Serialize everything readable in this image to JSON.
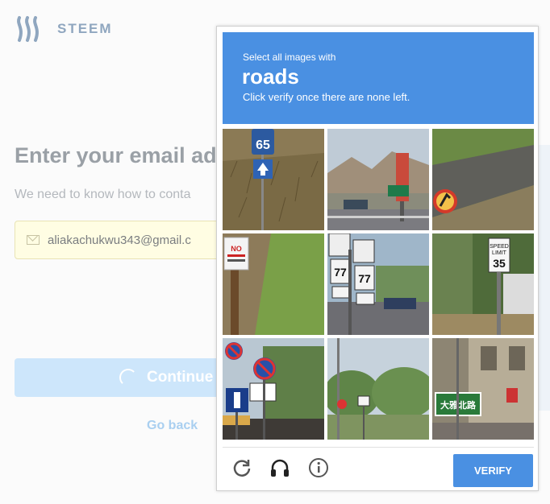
{
  "background": {
    "logo_text": "STEEM",
    "heading": "Enter your email ad",
    "subtext": "We need to know how to conta",
    "email_value": "aliakachukwu343@gmail.c",
    "continue_label": "Continue",
    "go_back_label": "Go back"
  },
  "captcha": {
    "instruction_prefix": "Select all images with",
    "keyword": "roads",
    "instruction_suffix": "Click verify once there are none left.",
    "verify_label": "VERIFY",
    "tools": [
      {
        "icon": "reload-icon"
      },
      {
        "icon": "headphones-icon"
      },
      {
        "icon": "info-icon"
      }
    ],
    "tiles": [
      {
        "name": "tile-1",
        "sign_text": "65"
      },
      {
        "name": "tile-2",
        "sign_text": ""
      },
      {
        "name": "tile-3",
        "sign_text": ""
      },
      {
        "name": "tile-4",
        "sign_text": "NO"
      },
      {
        "name": "tile-5",
        "sign_text": "77"
      },
      {
        "name": "tile-6",
        "sign_text": "35"
      },
      {
        "name": "tile-7",
        "sign_text": ""
      },
      {
        "name": "tile-8",
        "sign_text": ""
      },
      {
        "name": "tile-9",
        "sign_text": "大雅北路"
      }
    ]
  },
  "colors": {
    "accent": "#4a90e2",
    "steem_logo": "#8fa6bf"
  }
}
